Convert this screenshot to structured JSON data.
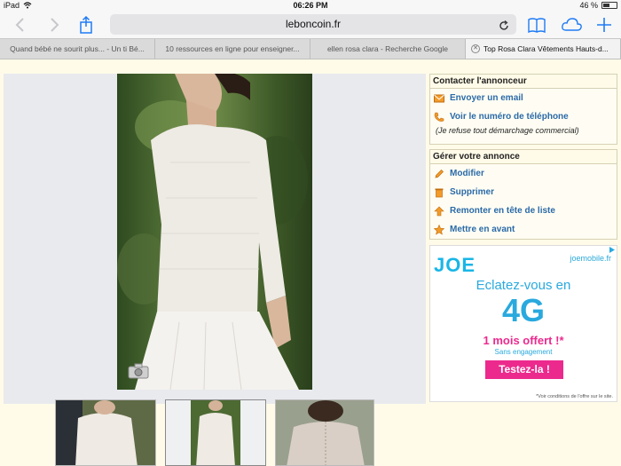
{
  "status_bar": {
    "device": "iPad",
    "time": "06:26 PM",
    "battery": "46 %"
  },
  "toolbar": {
    "url": "leboncoin.fr",
    "back_icon": "chevron-left-icon",
    "forward_icon": "chevron-right-icon",
    "share_icon": "share-icon",
    "reload_icon": "reload-icon",
    "bookmarks_icon": "book-icon",
    "cloud_icon": "cloud-icon",
    "new_tab_icon": "plus-icon"
  },
  "tabs": [
    {
      "label": "Quand bébé ne sourit plus... - Un ti Bé...",
      "active": false
    },
    {
      "label": "10 ressources en ligne pour enseigner...",
      "active": false
    },
    {
      "label": "ellen rosa clara - Recherche Google",
      "active": false
    },
    {
      "label": "Top Rosa Clara Vêtements Hauts-d...",
      "active": true
    }
  ],
  "contact_box": {
    "title": "Contacter l'annonceur",
    "items": [
      {
        "label": "Envoyer un email",
        "icon": "email-icon"
      },
      {
        "label": "Voir le numéro de téléphone",
        "icon": "phone-icon"
      }
    ],
    "note": "(Je refuse tout démarchage commercial)"
  },
  "manage_box": {
    "title": "Gérer votre annonce",
    "items": [
      {
        "label": "Modifier",
        "icon": "pencil-icon"
      },
      {
        "label": "Supprimer",
        "icon": "trash-icon"
      },
      {
        "label": "Remonter en tête de liste",
        "icon": "arrow-up-icon"
      },
      {
        "label": "Mettre en avant",
        "icon": "star-icon"
      }
    ]
  },
  "ad": {
    "logo": "JOE",
    "url": "joemobile.fr",
    "headline": "Eclatez-vous en",
    "highlight": "4G",
    "offer": "1 mois offert !*",
    "sub": "Sans engagement",
    "cta": "Testez-la !",
    "fine_print": "*Voir conditions de l'offre sur le site."
  },
  "colors": {
    "accent": "#1e7bf5",
    "link": "#2a6aa8",
    "ad_blue": "#29a9de",
    "ad_pink": "#ec2a8d",
    "page_bg": "#fffbe8"
  }
}
